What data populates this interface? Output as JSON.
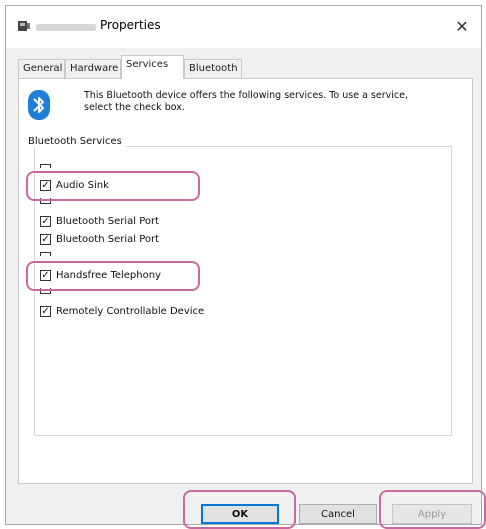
{
  "window": {
    "title": "Properties",
    "close_glyph": "✕"
  },
  "tabs": [
    {
      "label": "General"
    },
    {
      "label": "Hardware"
    },
    {
      "label": "Services"
    },
    {
      "label": "Bluetooth"
    }
  ],
  "active_tab": "Services",
  "info": {
    "text": "This Bluetooth device offers the following services. To use a service, select the check box.",
    "icon": "bluetooth-icon"
  },
  "services_group": {
    "label": "Bluetooth Services",
    "items": [
      {
        "label": "Audio Sink",
        "checked": true
      },
      {
        "label": "Bluetooth Serial Port",
        "checked": true
      },
      {
        "label": "Bluetooth Serial Port",
        "checked": true
      },
      {
        "label": "Handsfree Telephony",
        "checked": true
      },
      {
        "label": "Remotely Controllable Device",
        "checked": true
      }
    ]
  },
  "buttons": {
    "ok": "OK",
    "cancel": "Cancel",
    "apply": "Apply"
  },
  "colors": {
    "highlight": "#c86aa1",
    "accent": "#0078d7"
  }
}
